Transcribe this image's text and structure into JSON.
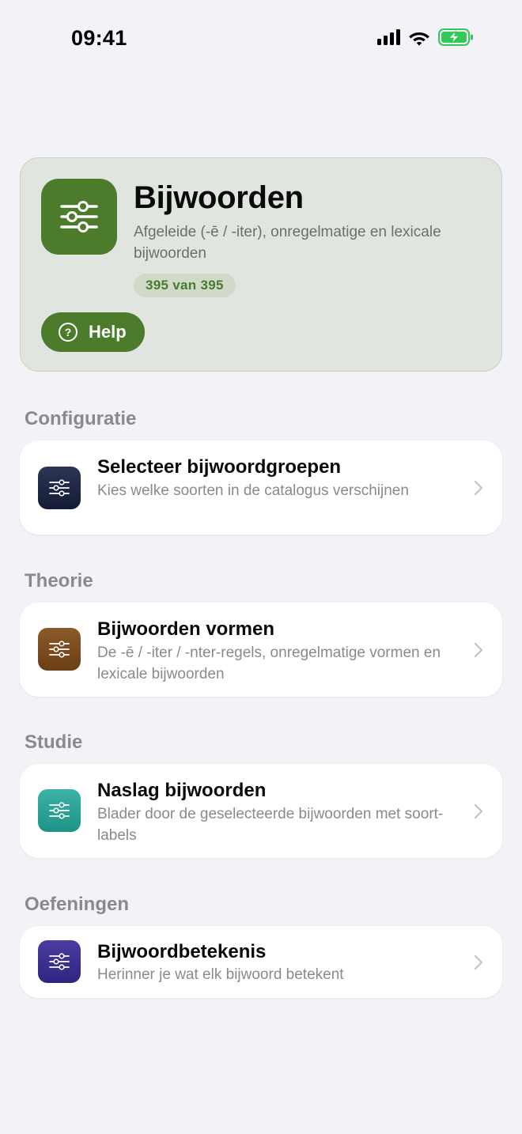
{
  "status_bar": {
    "time": "09:41",
    "icons": [
      "signal-icon",
      "wifi-icon",
      "battery-charging-icon"
    ],
    "battery_color": "#34c759"
  },
  "hero": {
    "title": "Bijwoorden",
    "subtitle": "Afgeleide (-ē / -iter), onregelmatige en lexicale bijwoorden",
    "badge": "395 van 395",
    "help_label": "Help",
    "icon": "sliders-icon",
    "accent_color": "#4b7b2b"
  },
  "sections": [
    {
      "header": "Configuratie",
      "item": {
        "title": "Selecteer bijwoordgroepen",
        "subtitle": "Kies welke soorten in de catalogus verschijnen",
        "icon": "sliders-icon",
        "icon_color": "#1c2442"
      }
    },
    {
      "header": "Theorie",
      "item": {
        "title": "Bijwoorden vormen",
        "subtitle": "De -ē / -iter / -nter-regels, onregelmatige vormen en lexicale bijwoorden",
        "icon": "sliders-icon",
        "icon_color": "#7a4a1c"
      }
    },
    {
      "header": "Studie",
      "item": {
        "title": "Naslag bijwoorden",
        "subtitle": "Blader door de geselecteerde bijwoorden met soort-labels",
        "icon": "sliders-icon",
        "icon_color": "#2aa296"
      }
    },
    {
      "header": "Oefeningen",
      "item": {
        "title": "Bijwoordbetekenis",
        "subtitle": "Herinner je wat elk bijwoord betekent",
        "icon": "sliders-icon",
        "icon_color": "#3b2f8f"
      }
    }
  ]
}
